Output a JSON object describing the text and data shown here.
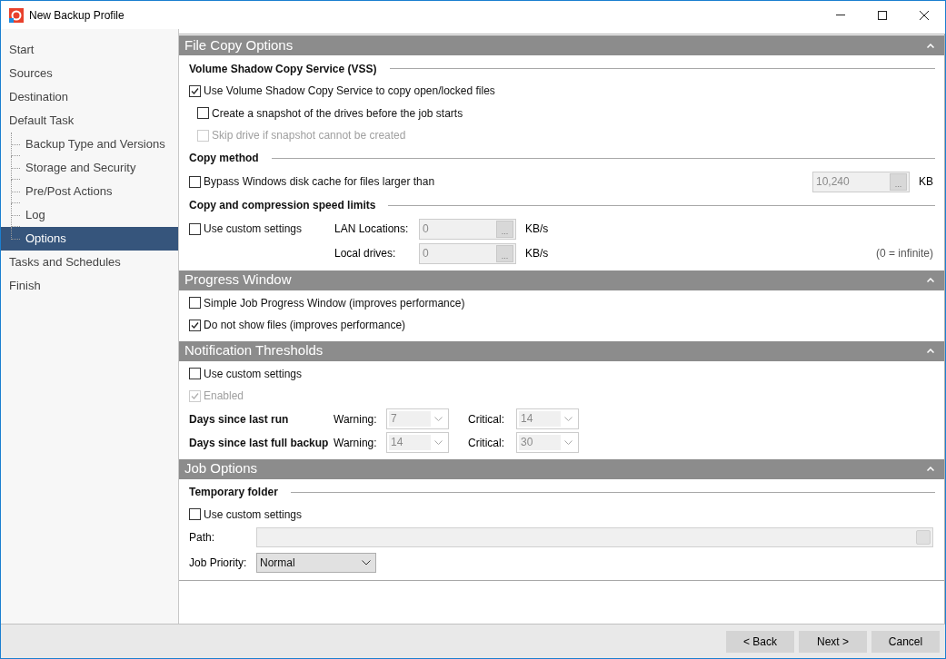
{
  "window": {
    "title": "New Backup Profile"
  },
  "sidebar": {
    "items": [
      {
        "label": "Start",
        "selected": false
      },
      {
        "label": "Sources",
        "selected": false
      },
      {
        "label": "Destination",
        "selected": false
      },
      {
        "label": "Default Task",
        "selected": false,
        "children": [
          {
            "label": "Backup Type and Versions",
            "selected": false
          },
          {
            "label": "Storage and Security",
            "selected": false
          },
          {
            "label": "Pre/Post Actions",
            "selected": false
          },
          {
            "label": "Log",
            "selected": false
          },
          {
            "label": "Options",
            "selected": true
          }
        ]
      },
      {
        "label": "Tasks and Schedules",
        "selected": false
      },
      {
        "label": "Finish",
        "selected": false
      }
    ]
  },
  "sections": [
    {
      "title": "File Copy Options",
      "expanded": true,
      "rows": [
        {
          "kind": "heading",
          "text": "Volume Shadow Copy Service (VSS)"
        },
        {
          "kind": "checkbox",
          "label": "Use Volume Shadow Copy Service to copy open/locked files",
          "checked": true,
          "disabled": false,
          "children": [
            {
              "label": "Create a snapshot of the drives before the job starts",
              "checked": false,
              "disabled": false
            },
            {
              "label": "Skip drive if snapshot cannot be created",
              "checked": false,
              "disabled": true
            }
          ]
        },
        {
          "kind": "heading",
          "text": "Copy method"
        },
        {
          "kind": "checkbox_field",
          "label": "Bypass Windows disk cache for files larger than",
          "checked": false,
          "disabled": false,
          "field": {
            "value": "10,240",
            "button": "...",
            "unit": "KB",
            "disabled": true
          }
        },
        {
          "kind": "heading",
          "text": "Copy and compression speed limits"
        },
        {
          "kind": "speed_limits",
          "label": "Use custom settings",
          "checked": false,
          "disabled": false,
          "note": "(0 = infinite)",
          "fields": [
            {
              "label": "LAN Locations:",
              "value": "0",
              "button": "...",
              "unit": "KB/s",
              "disabled": true
            },
            {
              "label": "Local drives:",
              "value": "0",
              "button": "...",
              "unit": "KB/s",
              "disabled": true
            }
          ]
        }
      ]
    },
    {
      "title": "Progress Window",
      "expanded": true,
      "rows": [
        {
          "kind": "checkbox",
          "label": "Simple Job Progress Window (improves performance)",
          "checked": false,
          "disabled": false
        },
        {
          "kind": "checkbox",
          "label": "Do not show files (improves performance)",
          "checked": true,
          "disabled": false
        }
      ]
    },
    {
      "title": "Notification Thresholds",
      "expanded": true,
      "rows": [
        {
          "kind": "checkbox",
          "label": "Use custom settings",
          "checked": false,
          "disabled": false
        },
        {
          "kind": "checkbox",
          "label": "Enabled",
          "checked": true,
          "disabled": true
        },
        {
          "kind": "threshold",
          "label": "Days since last run",
          "fields": [
            {
              "label": "Warning:",
              "value": "7",
              "disabled": true
            },
            {
              "label": "Critical:",
              "value": "14",
              "disabled": true
            }
          ]
        },
        {
          "kind": "threshold",
          "label": "Days since last full backup",
          "fields": [
            {
              "label": "Warning:",
              "value": "14",
              "disabled": true
            },
            {
              "label": "Critical:",
              "value": "30",
              "disabled": true
            }
          ]
        }
      ]
    },
    {
      "title": "Job Options",
      "expanded": true,
      "rows": [
        {
          "kind": "heading",
          "text": "Temporary folder"
        },
        {
          "kind": "checkbox",
          "label": "Use custom settings",
          "checked": false,
          "disabled": false
        },
        {
          "kind": "path",
          "label": "Path:",
          "disabled": true
        },
        {
          "kind": "select",
          "label": "Job Priority:",
          "value": "Normal",
          "disabled": false
        }
      ]
    }
  ],
  "buttons": [
    {
      "label": "< Back"
    },
    {
      "label": "Next >"
    },
    {
      "label": "Cancel"
    }
  ]
}
